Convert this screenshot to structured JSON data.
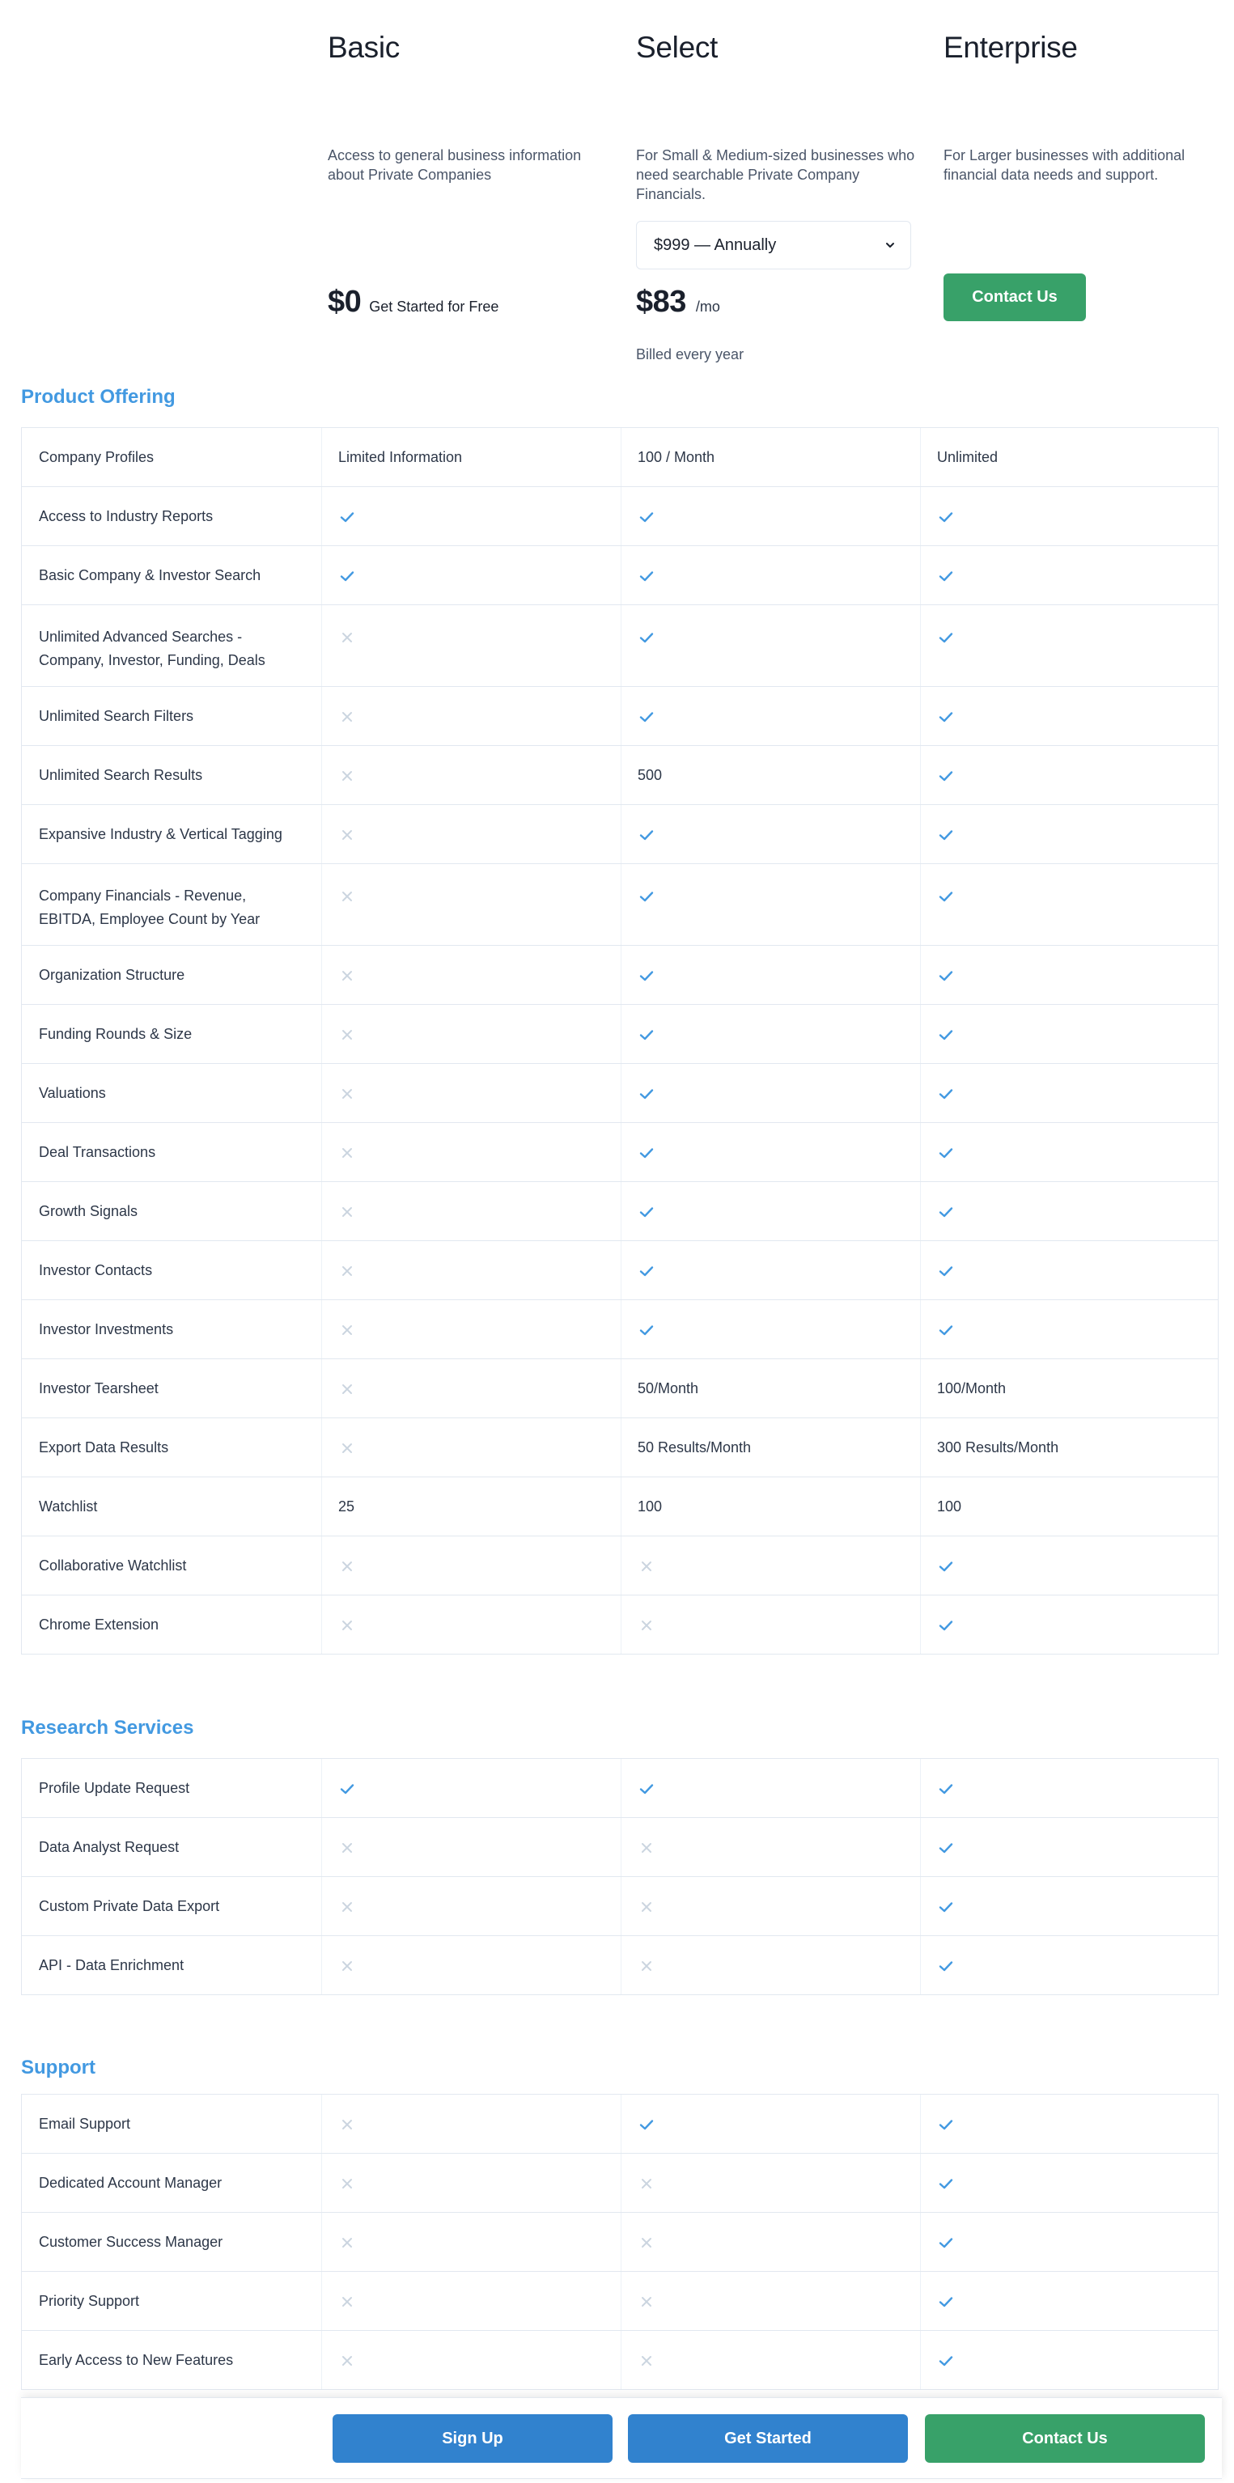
{
  "plans": [
    {
      "title": "Basic",
      "description": "Access to general business information about Private Companies",
      "price": "$0",
      "price_note": "Get Started for Free"
    },
    {
      "title": "Select",
      "description": "For Small & Medium-sized businesses who need searchable Private Company Financials.",
      "billing_select": {
        "selected": "$999 — Annually"
      },
      "price": "$83",
      "price_unit": "/mo",
      "billing_note": "Billed every year"
    },
    {
      "title": "Enterprise",
      "description": "For Larger businesses with additional financial data needs and support.",
      "cta_label": "Contact Us"
    }
  ],
  "icons": {
    "included": "check-icon",
    "excluded": "x-icon"
  },
  "colors": {
    "accent_blue": "#3182ce",
    "accent_green": "#38a169",
    "heading_blue": "#4299e1",
    "check": "#4299e1",
    "cross": "#cbd5e0"
  },
  "sections": [
    {
      "title": "Product Offering",
      "rows": [
        {
          "feature": "Company Profiles",
          "values": [
            "Limited Information",
            "100 / Month",
            "Unlimited"
          ]
        },
        {
          "feature": "Access to Industry Reports",
          "values": [
            "check",
            "check",
            "check"
          ]
        },
        {
          "feature": "Basic Company & Investor Search",
          "values": [
            "check",
            "check",
            "check"
          ]
        },
        {
          "feature": "Unlimited Advanced Searches - Company, Investor, Funding, Deals",
          "values": [
            "x",
            "check",
            "check"
          ],
          "tall": true
        },
        {
          "feature": "Unlimited Search Filters",
          "values": [
            "x",
            "check",
            "check"
          ]
        },
        {
          "feature": "Unlimited Search Results",
          "values": [
            "x",
            "500",
            "check"
          ]
        },
        {
          "feature": "Expansive Industry & Vertical Tagging",
          "values": [
            "x",
            "check",
            "check"
          ]
        },
        {
          "feature": "Company Financials - Revenue, EBITDA, Employee Count by Year",
          "values": [
            "x",
            "check",
            "check"
          ],
          "tall": true
        },
        {
          "feature": "Organization Structure",
          "values": [
            "x",
            "check",
            "check"
          ]
        },
        {
          "feature": "Funding Rounds & Size",
          "values": [
            "x",
            "check",
            "check"
          ]
        },
        {
          "feature": "Valuations",
          "values": [
            "x",
            "check",
            "check"
          ]
        },
        {
          "feature": "Deal Transactions",
          "values": [
            "x",
            "check",
            "check"
          ]
        },
        {
          "feature": "Growth Signals",
          "values": [
            "x",
            "check",
            "check"
          ]
        },
        {
          "feature": "Investor Contacts",
          "values": [
            "x",
            "check",
            "check"
          ]
        },
        {
          "feature": "Investor Investments",
          "values": [
            "x",
            "check",
            "check"
          ]
        },
        {
          "feature": "Investor Tearsheet",
          "values": [
            "x",
            "50/Month",
            "100/Month"
          ]
        },
        {
          "feature": "Export Data Results",
          "values": [
            "x",
            "50 Results/Month",
            "300 Results/Month"
          ]
        },
        {
          "feature": "Watchlist",
          "values": [
            "25",
            "100",
            "100"
          ]
        },
        {
          "feature": "Collaborative Watchlist",
          "values": [
            "x",
            "x",
            "check"
          ]
        },
        {
          "feature": "Chrome Extension",
          "values": [
            "x",
            "x",
            "check"
          ]
        }
      ]
    },
    {
      "title": "Research Services",
      "rows": [
        {
          "feature": "Profile Update Request",
          "values": [
            "check",
            "check",
            "check"
          ]
        },
        {
          "feature": "Data Analyst Request",
          "values": [
            "x",
            "x",
            "check"
          ]
        },
        {
          "feature": "Custom Private Data Export",
          "values": [
            "x",
            "x",
            "check"
          ]
        },
        {
          "feature": "API - Data Enrichment",
          "values": [
            "x",
            "x",
            "check"
          ]
        }
      ]
    },
    {
      "title": "Support",
      "rows": [
        {
          "feature": "Email Support",
          "values": [
            "x",
            "check",
            "check"
          ]
        },
        {
          "feature": "Dedicated Account Manager",
          "values": [
            "x",
            "x",
            "check"
          ]
        },
        {
          "feature": "Customer Success Manager",
          "values": [
            "x",
            "x",
            "check"
          ]
        },
        {
          "feature": "Priority Support",
          "values": [
            "x",
            "x",
            "check"
          ]
        },
        {
          "feature": "Early Access to New Features",
          "values": [
            "x",
            "x",
            "check"
          ]
        }
      ]
    }
  ],
  "footer": {
    "sign_up_label": "Sign Up",
    "get_started_label": "Get Started",
    "contact_us_label": "Contact Us"
  }
}
